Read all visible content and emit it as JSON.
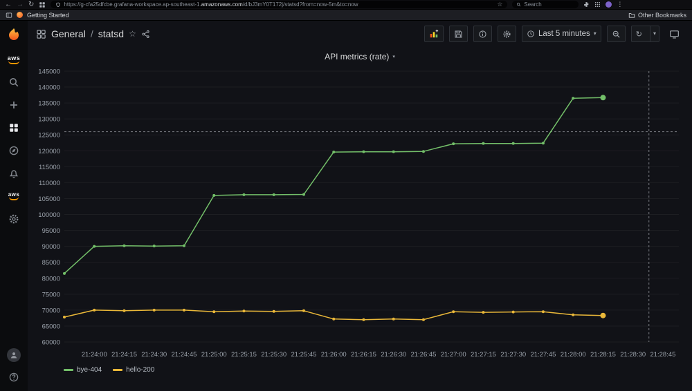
{
  "browser": {
    "url_prefix": "https://g-cfa25dfcbe.grafana-workspace.ap-southeast-1.",
    "url_domain": "amazonaws.com",
    "url_path": "/d/bJ3mY0T172j/statsd?from=now-5m&to=now",
    "search_placeholder": "Search",
    "bookmarks": {
      "getting_started": "Getting Started",
      "other_bookmarks": "Other Bookmarks"
    }
  },
  "icons": {
    "back": "←",
    "forward": "→",
    "reload": "↻",
    "refresh": "↻",
    "star": "☆",
    "caret_down": "▾",
    "menu_dots": "⋮"
  },
  "header": {
    "breadcrumb_root": "General",
    "breadcrumb_sep": "/",
    "breadcrumb_page": "statsd",
    "time_range_label": "Last 5 minutes"
  },
  "panel": {
    "title": "API metrics (rate)"
  },
  "chart_data": {
    "type": "line",
    "title": "API metrics (rate)",
    "ylim": [
      60000,
      145000
    ],
    "y_ticks": [
      60000,
      65000,
      70000,
      75000,
      80000,
      85000,
      90000,
      95000,
      100000,
      105000,
      110000,
      115000,
      120000,
      125000,
      130000,
      135000,
      140000,
      145000
    ],
    "x_ticks": [
      "21:24:00",
      "21:24:15",
      "21:24:30",
      "21:24:45",
      "21:25:00",
      "21:25:15",
      "21:25:30",
      "21:25:45",
      "21:26:00",
      "21:26:15",
      "21:26:30",
      "21:26:45",
      "21:27:00",
      "21:27:15",
      "21:27:30",
      "21:27:45",
      "21:28:00",
      "21:28:15",
      "21:28:30",
      "21:28:45"
    ],
    "x_tick_interval_s": 15,
    "t_domain": [
      -15,
      293
    ],
    "threshold_y": 126000,
    "cursor_t": 278,
    "grid": "faint-horizontal",
    "legend_position": "bottom-left",
    "series": [
      {
        "name": "bye-404",
        "color": "#73bf69",
        "points": [
          [
            -15,
            81500
          ],
          [
            0,
            90000
          ],
          [
            15,
            90200
          ],
          [
            30,
            90100
          ],
          [
            45,
            90200
          ],
          [
            60,
            106000
          ],
          [
            75,
            106200
          ],
          [
            90,
            106200
          ],
          [
            105,
            106300
          ],
          [
            120,
            119600
          ],
          [
            135,
            119700
          ],
          [
            150,
            119700
          ],
          [
            165,
            119800
          ],
          [
            180,
            122200
          ],
          [
            195,
            122300
          ],
          [
            210,
            122300
          ],
          [
            225,
            122400
          ],
          [
            240,
            136500
          ],
          [
            255,
            136700
          ]
        ]
      },
      {
        "name": "hello-200",
        "color": "#eab839",
        "points": [
          [
            -15,
            67800
          ],
          [
            0,
            70000
          ],
          [
            15,
            69800
          ],
          [
            30,
            70000
          ],
          [
            45,
            70000
          ],
          [
            60,
            69500
          ],
          [
            75,
            69700
          ],
          [
            90,
            69600
          ],
          [
            105,
            69800
          ],
          [
            120,
            67200
          ],
          [
            135,
            67000
          ],
          [
            150,
            67200
          ],
          [
            165,
            67000
          ],
          [
            180,
            69500
          ],
          [
            195,
            69300
          ],
          [
            210,
            69400
          ],
          [
            225,
            69500
          ],
          [
            240,
            68500
          ],
          [
            255,
            68300
          ]
        ]
      }
    ]
  }
}
